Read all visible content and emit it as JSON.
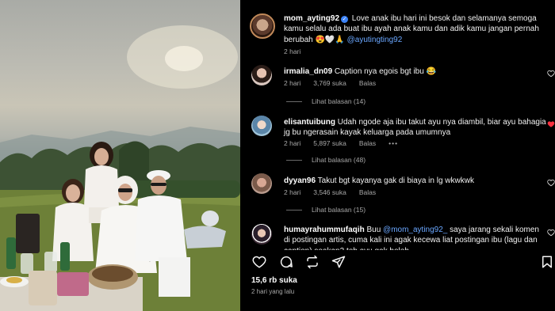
{
  "caption": {
    "username": "mom_ayting92",
    "text": " Love anak ibu hari ini besok dan selamanya semoga kamu selalu ada buat ibu ayah anak kamu dan adik kamu jangan pernah berubah 😍🤍🙏 ",
    "mention": "@ayutingting92",
    "time": "2 hari"
  },
  "comments": [
    {
      "username": "irmalia_dn09",
      "text": " Caption nya egois bgt ibu 😂",
      "time": "2 hari",
      "likes": "3,769 suka",
      "reply_label": "Balas",
      "view_replies": "Lihat balasan (14)",
      "liked": false
    },
    {
      "username": "elisantuibung",
      "text": " Udah ngode aja ibu takut ayu nya diambil, biar ayu bahagia jg bu ngerasain kayak keluarga pada umumnya",
      "time": "2 hari",
      "likes": "5,897 suka",
      "reply_label": "Balas",
      "more": "•••",
      "view_replies": "Lihat balasan (48)",
      "liked": true
    },
    {
      "username": "dyyan96",
      "text": " Takut bgt kayanya gak di biaya in lg wkwkwk",
      "time": "2 hari",
      "likes": "3,546 suka",
      "reply_label": "Balas",
      "view_replies": "Lihat balasan (15)",
      "liked": false
    },
    {
      "username": "humayrahummufaqih",
      "text_before": " Buu ",
      "mention": "@mom_ayting92_",
      "text_after": " saya jarang sekali komen di postingan artis, cuma kali ini agak kecewa liat postingan ibu (lagu dan caption) seakan2 teh ayu gak boleh",
      "liked": false
    }
  ],
  "actions": {
    "icons": [
      "heart-icon",
      "comment-icon",
      "repost-icon",
      "share-icon",
      "bookmark-icon"
    ]
  },
  "likes_total": "15,6 rb suka",
  "posted": "2 hari yang lalu",
  "colors": {
    "background": "#000000",
    "text": "#f5f5f5",
    "muted": "#a8a8a8",
    "mention": "#6aa7ff",
    "verified": "#3b82f6",
    "liked_heart": "#ff3040"
  }
}
